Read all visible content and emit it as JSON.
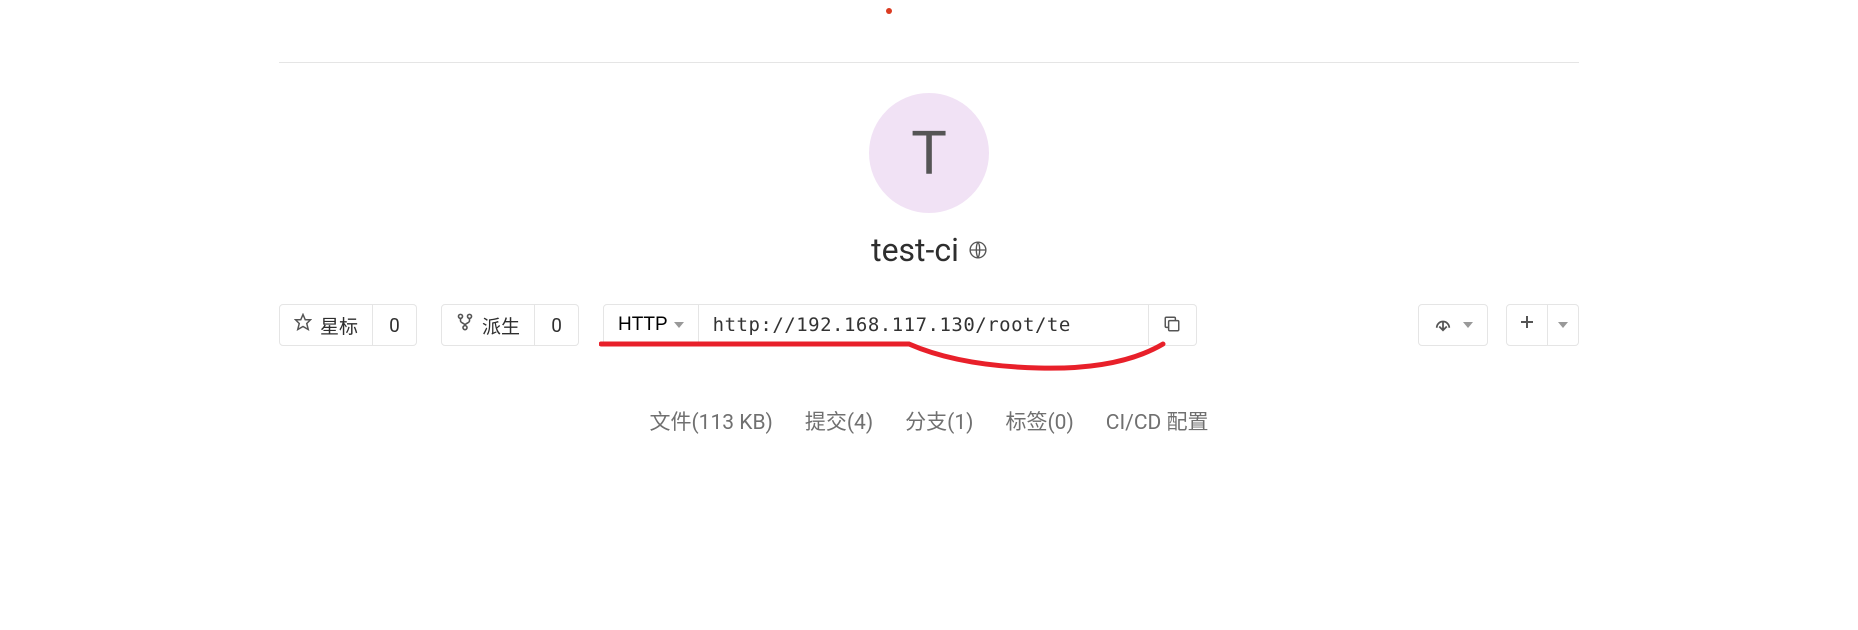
{
  "project": {
    "avatar_letter": "T",
    "name": "test-ci",
    "visibility": "public"
  },
  "actions": {
    "star_label": "星标",
    "star_count": "0",
    "fork_label": "派生",
    "fork_count": "0"
  },
  "clone": {
    "protocol": "HTTP",
    "url": "http://192.168.117.130/root/te"
  },
  "stats": {
    "files_label": "文件",
    "files_size": "(113 KB)",
    "commits_label": "提交",
    "commits_count": "(4)",
    "branches_label": "分支",
    "branches_count": "(1)",
    "tags_label": "标签",
    "tags_count": "(0)",
    "cicd_label": "CI/CD 配置"
  }
}
